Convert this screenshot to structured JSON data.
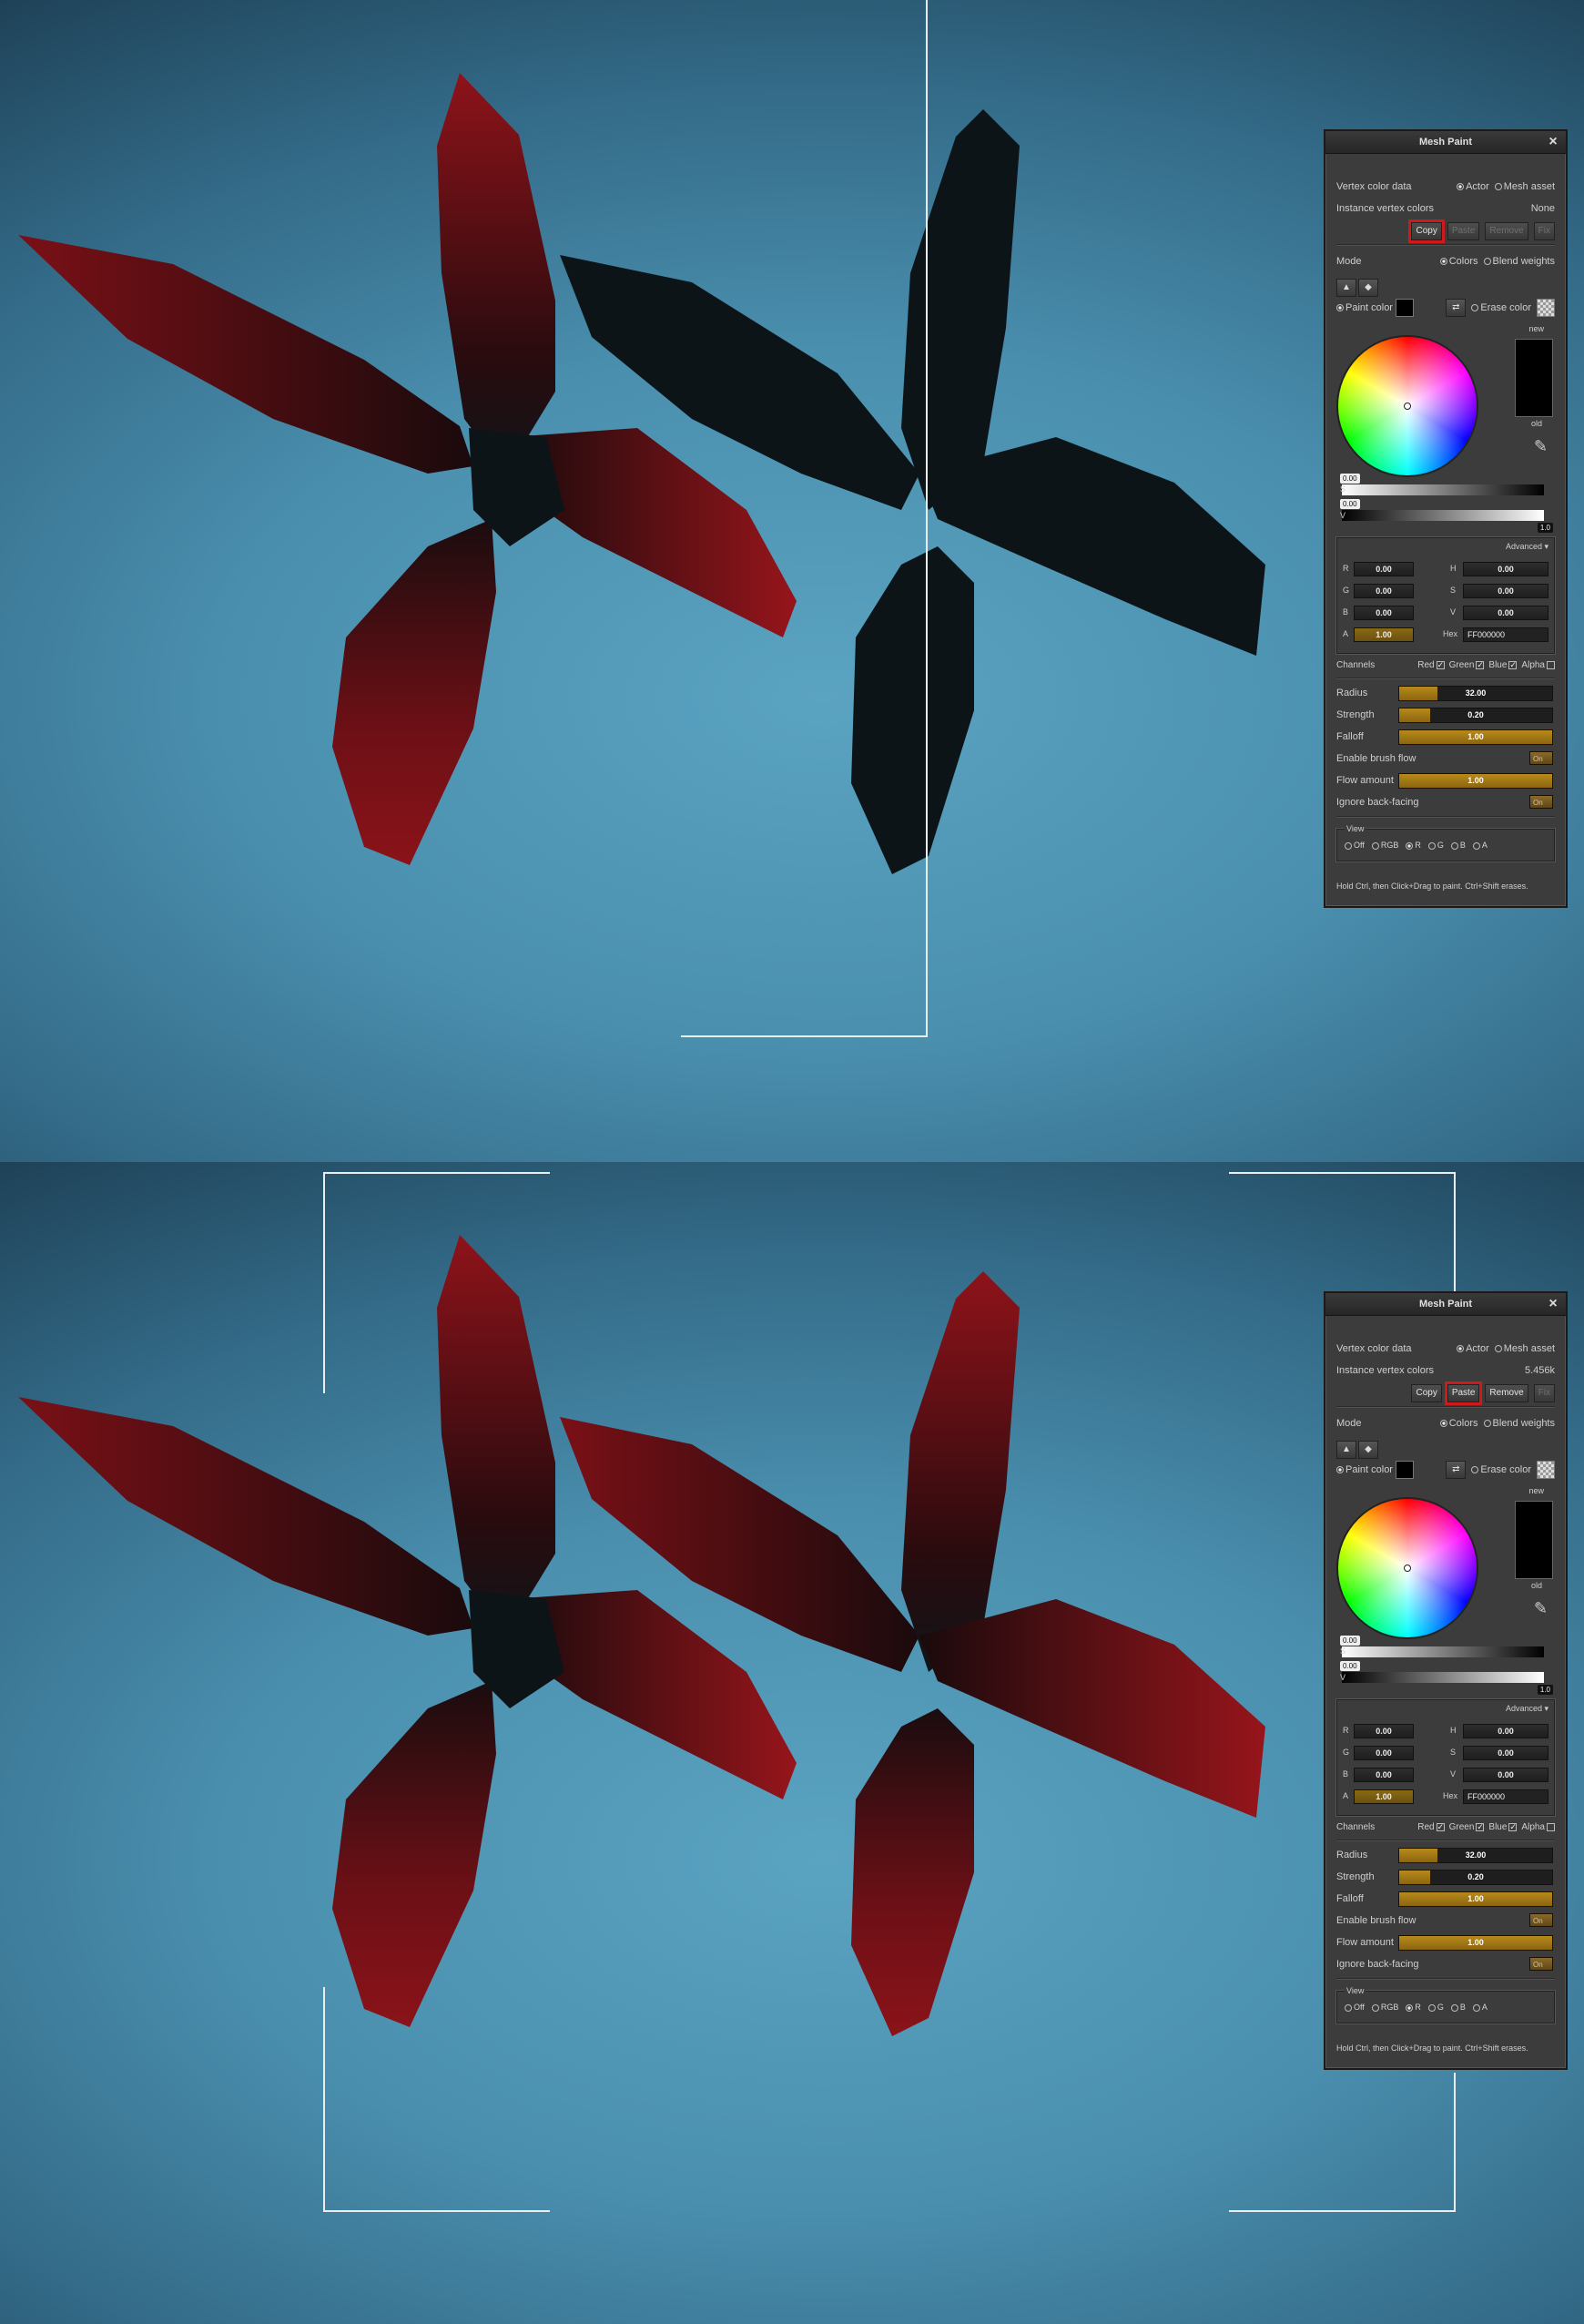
{
  "panel_title": "Mesh Paint",
  "labels": {
    "vertex_color_data": "Vertex color data",
    "actor": "Actor",
    "mesh_asset": "Mesh asset",
    "instance_vertex_colors": "Instance vertex colors",
    "copy": "Copy",
    "paste": "Paste",
    "remove": "Remove",
    "fix": "Fix",
    "mode": "Mode",
    "colors": "Colors",
    "blend_weights": "Blend weights",
    "paint_color": "Paint color",
    "erase_color": "Erase color",
    "new": "new",
    "old": "old",
    "s": "S",
    "v": "V",
    "advanced": "Advanced",
    "r": "R",
    "g": "G",
    "b": "B",
    "a": "A",
    "h": "H",
    "s2": "S",
    "v2": "V",
    "hex": "Hex",
    "channels": "Channels",
    "red": "Red",
    "green": "Green",
    "blue": "Blue",
    "alpha": "Alpha",
    "radius": "Radius",
    "strength": "Strength",
    "falloff": "Falloff",
    "enable_brush_flow": "Enable brush flow",
    "flow_amount": "Flow amount",
    "ignore_back_facing": "Ignore back-facing",
    "view": "View",
    "view_off": "Off",
    "view_rgb": "RGB",
    "view_r": "R",
    "view_g": "G",
    "view_b": "B",
    "view_a": "A",
    "hint": "Hold Ctrl, then Click+Drag to paint. Ctrl+Shift erases.",
    "on": "On"
  },
  "values": {
    "s_value": "0.00",
    "v_value": "0.00",
    "v_max": "1.0",
    "r": "0.00",
    "g": "0.00",
    "b": "0.00",
    "a": "1.00",
    "h": "0.00",
    "s": "0.00",
    "v": "0.00",
    "hex": "FF000000",
    "radius": "32.00",
    "strength": "0.20",
    "falloff": "1.00",
    "flow_amount": "1.00"
  },
  "panels": [
    {
      "instance_vertex_colors_value": "None",
      "highlighted": "copy"
    },
    {
      "instance_vertex_colors_value": "5.456k",
      "highlighted": "paste"
    }
  ],
  "colors": {
    "leaf_red": "#8c1116",
    "leaf_black": "#0c1418",
    "highlight": "#d0191a",
    "gauge": "#b88a1a"
  }
}
